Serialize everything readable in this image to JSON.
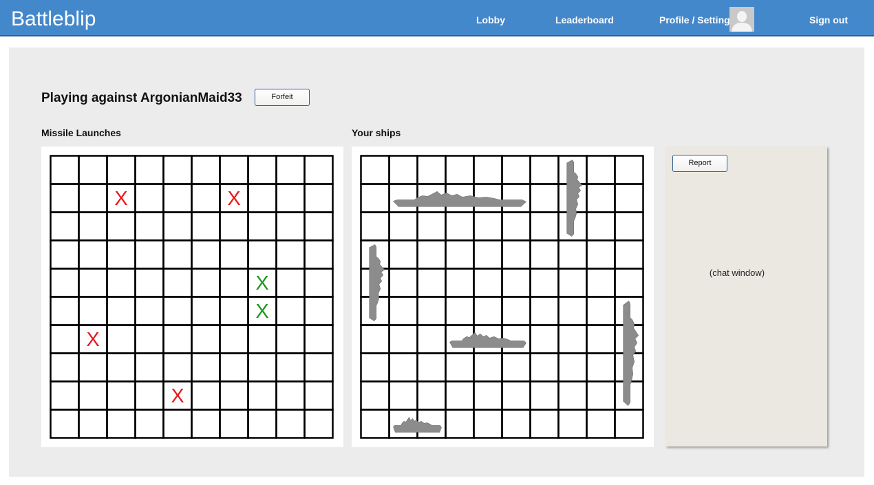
{
  "header": {
    "brand": "Battleblip",
    "nav": {
      "lobby": "Lobby",
      "leaderboard": "Leaderboard",
      "profile": "Profile / Settings",
      "signout": "Sign out"
    }
  },
  "game": {
    "title": "Playing against ArgonianMaid33",
    "forfeit_label": "Forfeit",
    "missile_label": "Missile Launches",
    "ships_label": "Your ships",
    "grid_size": 10
  },
  "missile_marks": [
    {
      "row": 1,
      "col": 2,
      "symbol": "X",
      "result": "miss"
    },
    {
      "row": 1,
      "col": 6,
      "symbol": "X",
      "result": "miss"
    },
    {
      "row": 4,
      "col": 7,
      "symbol": "X",
      "result": "hit"
    },
    {
      "row": 5,
      "col": 7,
      "symbol": "X",
      "result": "hit"
    },
    {
      "row": 6,
      "col": 1,
      "symbol": "X",
      "result": "miss"
    },
    {
      "row": 8,
      "col": 4,
      "symbol": "X",
      "result": "miss"
    }
  ],
  "ships": [
    {
      "row": 1,
      "col": 1,
      "length": 5,
      "orientation": "horizontal"
    },
    {
      "row": 0,
      "col": 7,
      "length": 3,
      "orientation": "vertical"
    },
    {
      "row": 3,
      "col": 0,
      "length": 3,
      "orientation": "vertical"
    },
    {
      "row": 6,
      "col": 3,
      "length": 3,
      "orientation": "horizontal"
    },
    {
      "row": 5,
      "col": 9,
      "length": 4,
      "orientation": "vertical"
    },
    {
      "row": 9,
      "col": 1,
      "length": 2,
      "orientation": "horizontal"
    }
  ],
  "chat": {
    "report_label": "Report",
    "placeholder_text": "(chat window)"
  },
  "colors": {
    "header": "#4488cc",
    "miss": "#e8191d",
    "hit": "#1b9a1b",
    "ship": "#8c8c8c",
    "panel": "#ececec",
    "chat_bg": "#ebe8e2"
  }
}
